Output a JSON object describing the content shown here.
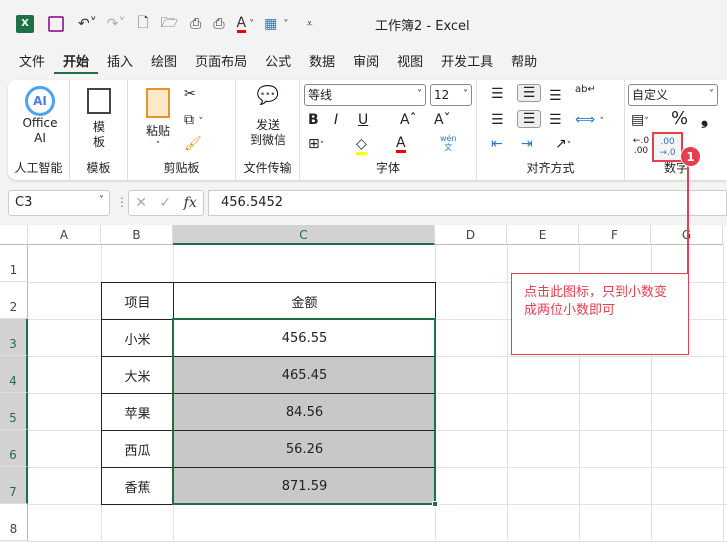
{
  "titlebar": {
    "title": "工作簿2  -  Excel",
    "quick_icons": [
      "excel-logo-icon",
      "save-icon",
      "undo-icon",
      "redo-icon",
      "new-file-icon",
      "open-icon",
      "print-preview-icon",
      "print-icon",
      "font-color-icon",
      "table-icon",
      "customize-icon"
    ]
  },
  "tabs": [
    "文件",
    "开始",
    "插入",
    "绘图",
    "页面布局",
    "公式",
    "数据",
    "审阅",
    "视图",
    "开发工具",
    "帮助"
  ],
  "ribbon": {
    "ai": {
      "label1": "Office",
      "label2": "AI",
      "group": "人工智能"
    },
    "template": {
      "label1": "模",
      "label2": "板",
      "group": "模板"
    },
    "clipboard": {
      "paste": "粘贴",
      "group": "剪贴板"
    },
    "transfer": {
      "label1": "发送",
      "label2": "到微信",
      "group": "文件传输"
    },
    "font": {
      "name": "等线",
      "size": "12",
      "bold": "B",
      "italic": "I",
      "underline": "U",
      "grow": "Aˆ",
      "shrink": "Aˇ",
      "group": "字体",
      "phonetic": "wén"
    },
    "align": {
      "group": "对齐方式"
    },
    "number": {
      "format": "自定义",
      "percent": "%",
      "comma": "❟",
      "group": "数字",
      "decrease": "←.0 .00",
      "increase": ".00 →.0"
    },
    "colors": {
      "accent": "#1e7145",
      "highlight": "#e53e4e"
    }
  },
  "formula": {
    "cell_ref": "C3",
    "fx": "fx",
    "value": "456.5452"
  },
  "columns": [
    "A",
    "B",
    "C",
    "D",
    "E",
    "F",
    "G"
  ],
  "rows": [
    "1",
    "2",
    "3",
    "4",
    "5",
    "6",
    "7",
    "8"
  ],
  "table": {
    "headers": [
      "项目",
      "金额"
    ],
    "rows": [
      [
        "小米",
        "456.55"
      ],
      [
        "大米",
        "465.45"
      ],
      [
        "苹果",
        "84.56"
      ],
      [
        "西瓜",
        "56.26"
      ],
      [
        "香蕉",
        "871.59"
      ]
    ]
  },
  "callout": {
    "badge": "1",
    "text": "点击此图标，只到小数变成两位小数即可"
  }
}
